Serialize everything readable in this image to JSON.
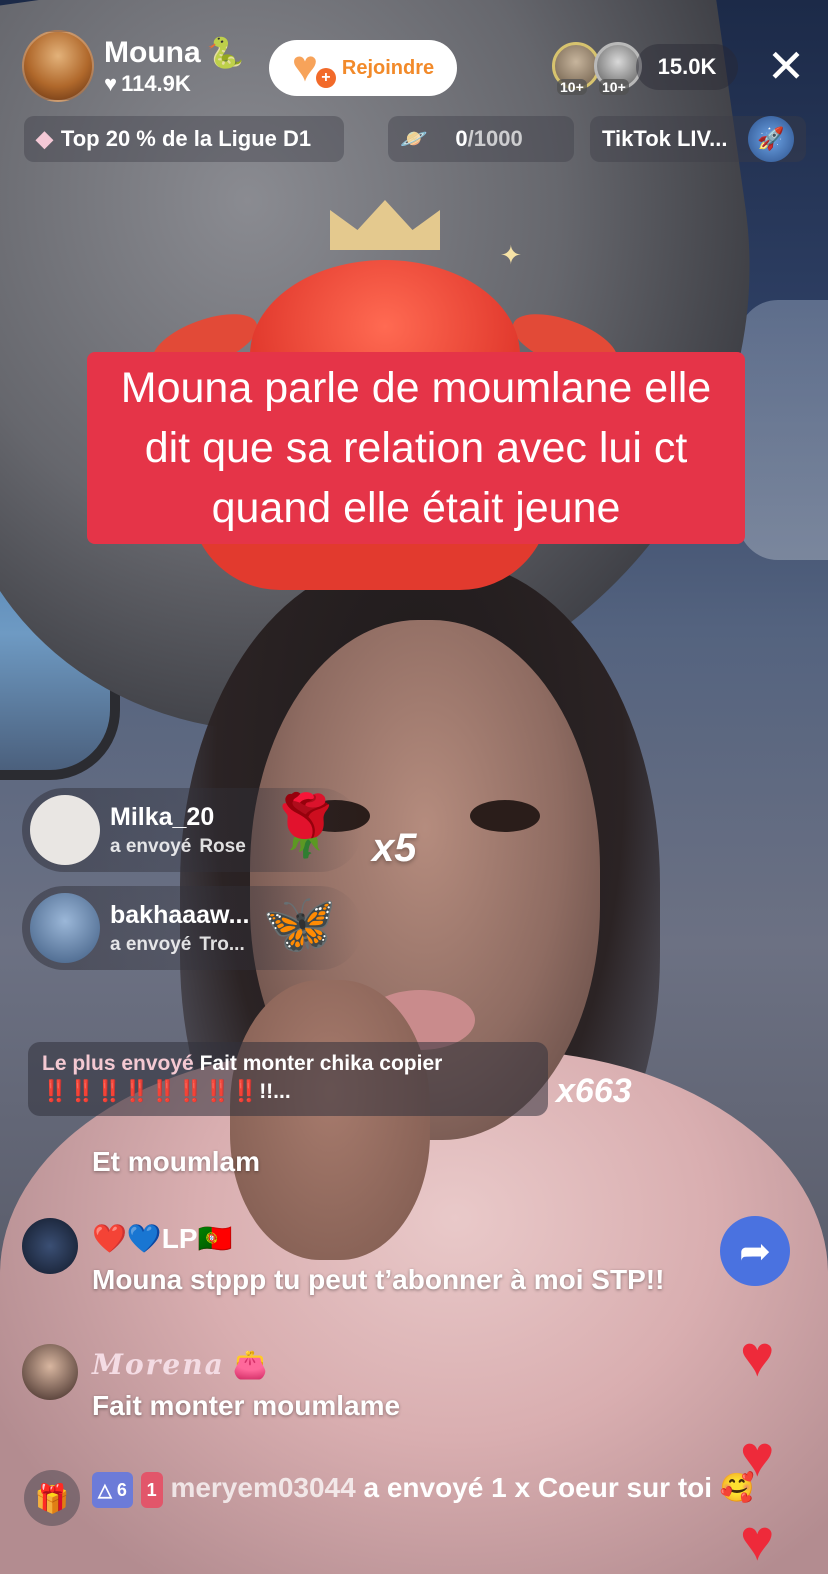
{
  "host": {
    "name": "Mouna",
    "name_emoji": "🐍",
    "likes": "114.9K",
    "join_label": "Rejoindre"
  },
  "viewers": {
    "badge_1": "10+",
    "badge_2": "10+",
    "count": "15.0K"
  },
  "chips": {
    "league": "Top 20 % de la Ligue D1",
    "score_current": "0",
    "score_goal": "/1000",
    "live_label": "TikTok LIV..."
  },
  "caption": "Mouna parle de moumlane elle dit que sa relation avec lui ct quand elle était jeune",
  "gifts": [
    {
      "user": "Milka_20",
      "sent_label": "a envoyé",
      "gift": "Rose",
      "icon": "🌹",
      "multiplier": "x5"
    },
    {
      "user": "bakhaaaw...",
      "sent_label": "a envoyé",
      "gift": "Tro...",
      "icon": "🦋",
      "multiplier": ""
    }
  ],
  "most_sent": {
    "label": "Le plus envoyé",
    "text": "Fait monter chika copier",
    "bangs": "‼️‼️‼️‼️‼️‼️‼️‼️",
    "tail": "!!...",
    "multiplier": "x663"
  },
  "comments": [
    {
      "user": "",
      "body": "Et moumlam"
    },
    {
      "user": "❤️💙LP🇵🇹",
      "body": "Mouna stppp tu peut t’abonner à moi STP!!"
    },
    {
      "user": "Morena",
      "user_emoji": "👛",
      "body": "Fait monter moumlame"
    }
  ],
  "system_message": {
    "level": "6",
    "fan_level": "1",
    "user": "meryem03044",
    "text": "a envoyé 1 x Coeur sur toi"
  },
  "colors": {
    "caption_bg": "#e53448",
    "join_text": "#f28a2a",
    "share_btn": "#4a72e0",
    "heart": "#ee2a3a"
  }
}
